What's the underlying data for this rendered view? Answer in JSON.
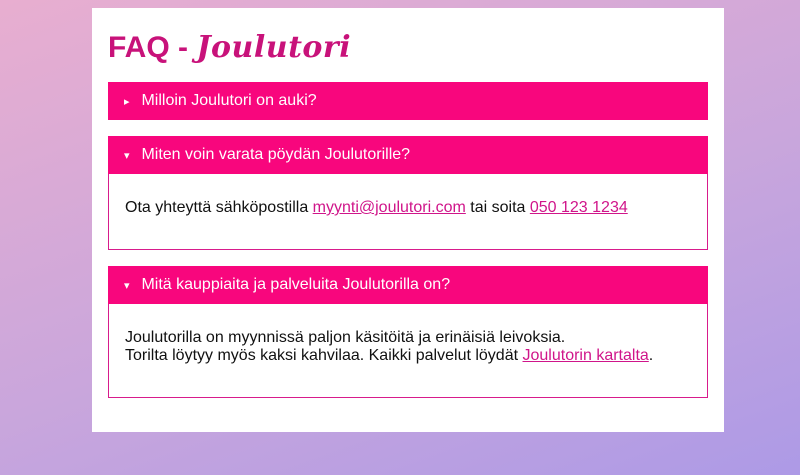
{
  "page": {
    "title_prefix": "FAQ - ",
    "title_script": "Joulutori"
  },
  "faq": {
    "q1": {
      "arrow": "▸",
      "question": "Milloin Joulutori on auki?",
      "expanded": false
    },
    "q2": {
      "arrow": "▾",
      "question": "Miten voin varata pöydän Joulutorille?",
      "expanded": true,
      "answer_text1": "Ota yhteyttä sähköpostilla ",
      "email_link": "myynti@joulutori.com",
      "answer_text2": " tai soita ",
      "phone_link": "050 123 1234"
    },
    "q3": {
      "arrow": "▾",
      "question": "Mitä kauppiaita ja palveluita Joulutorilla on?",
      "expanded": true,
      "line1": "Joulutorilla on myynnissä paljon käsitöitä ja erinäisiä leivoksia.",
      "line2": "Torilta löytyy myös kaksi kahvilaa. Kaikki palvelut löydät ",
      "map_link": "Joulutorin kartalta",
      "line2_end": "."
    }
  },
  "colors": {
    "accent": "#f8067d",
    "title": "#c8127a",
    "link": "#d0158a",
    "border": "#d81b8c"
  }
}
